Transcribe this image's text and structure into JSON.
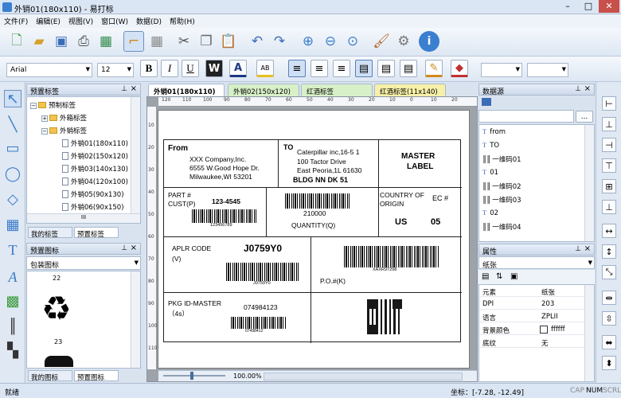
{
  "window": {
    "title": "外销01(180x110) - 易打标",
    "min": "–",
    "max": "□",
    "close": "✕"
  },
  "menu": [
    "文件(F)",
    "编辑(E)",
    "视图(V)",
    "窗口(W)",
    "数据(D)",
    "帮助(H)"
  ],
  "toolbar2": {
    "font": "Arial",
    "size": "12",
    "bold": "B",
    "italic": "I",
    "underline": "U",
    "w": "W",
    "fontcolor": "A",
    "abc": "AB"
  },
  "preset_labels": {
    "title": "预置标签",
    "tree": [
      {
        "label": "预制标签",
        "level": 0,
        "sign": "−"
      },
      {
        "label": "外箱标签",
        "level": 1,
        "sign": "+"
      },
      {
        "label": "外销标签",
        "level": 1,
        "sign": "−"
      },
      {
        "label": "外销01(180x110)",
        "level": 2
      },
      {
        "label": "外销02(150x120)",
        "level": 2
      },
      {
        "label": "外销03(140x130)",
        "level": 2
      },
      {
        "label": "外销04(120x100)",
        "level": 2
      },
      {
        "label": "外销05(90x130)",
        "level": 2
      },
      {
        "label": "外销06(90x150)",
        "level": 2
      }
    ],
    "tabs": [
      "我的标签",
      "预置标签"
    ],
    "scroll_thumb": "III"
  },
  "preset_icons": {
    "title": "预置图标",
    "category": "包装图标",
    "item1": "22",
    "item2": "23",
    "tabs": [
      "我的图标",
      "预置图标"
    ]
  },
  "doc_tabs": [
    "外销01(180x110)",
    "外销02(150x120)",
    "红酒标签(100x140)",
    "红酒标签(11x140)"
  ],
  "ruler_h": [
    "120",
    "110",
    "100",
    "90",
    "80",
    "70",
    "60",
    "50",
    "40",
    "30",
    "20",
    "10",
    "0",
    "10",
    "20"
  ],
  "ruler_v": [
    "10",
    "20",
    "30",
    "40",
    "50",
    "60",
    "70",
    "80",
    "90",
    "100",
    "110"
  ],
  "label": {
    "from_title": "From",
    "from_lines": [
      "XXX Company,Inc.",
      "6555 W.Good Hope Dr.",
      "Milwaukee,WI 53201"
    ],
    "to_title": "TO",
    "to_lines": [
      "Caterpillar inc,16-5 1",
      "100 Tactor Drive",
      "East Peoria,1L 61630"
    ],
    "to_bold": "BLDG NN DK 51",
    "master": "MASTER",
    "master2": "LABEL",
    "part": "PART #",
    "cust": "CUST(P)",
    "part_no": "123-4545",
    "part_bc_text": "123456789",
    "qty_no": "210000",
    "qty_label": "QUANTITY(Q)",
    "country": "COUNTRY OF",
    "origin": "ORIGIN",
    "us": "US",
    "ec": "EC #",
    "ec_no": "05",
    "aplr": "APLR CODE",
    "aplr_v": "(V)",
    "aplr_code": "J0759Y0",
    "aplr_bc_text": "J0759Y0",
    "po_bc_text": "XAXR97298",
    "po": "P.O.#(K)",
    "pkg": "PKG ID-MASTER",
    "pkg_s": "（4s）",
    "pkg_no": "074984123",
    "pkg_bc_text": "07498412"
  },
  "hscroll": {
    "zoom": "100.00%"
  },
  "datasource": {
    "title": "数据源",
    "browse": "...",
    "items": [
      "from",
      "TO",
      "一维码01",
      "01",
      "一维码02",
      "一维码03",
      "02",
      "一维码04"
    ]
  },
  "properties": {
    "title": "属性",
    "selector": "纸张",
    "rows": [
      {
        "key": "元素",
        "value": "纸张"
      },
      {
        "key": "DPI",
        "value": "203"
      },
      {
        "key": "语言",
        "value": "ZPLII"
      },
      {
        "key": "背景颜色",
        "value": "ffffff"
      },
      {
        "key": "底纹",
        "value": "无"
      }
    ]
  },
  "status": {
    "left": "就绪",
    "coord": "坐标：[-7.28, -12.49]",
    "cap": "CAP",
    "num": "NUM",
    "scrl": "SCRL"
  },
  "colors": {
    "accent": "#3b7fd0",
    "selected_tab": "#ffffff",
    "tab_green": "#d8f0c8",
    "tab_yellow": "#f7f0a8"
  }
}
